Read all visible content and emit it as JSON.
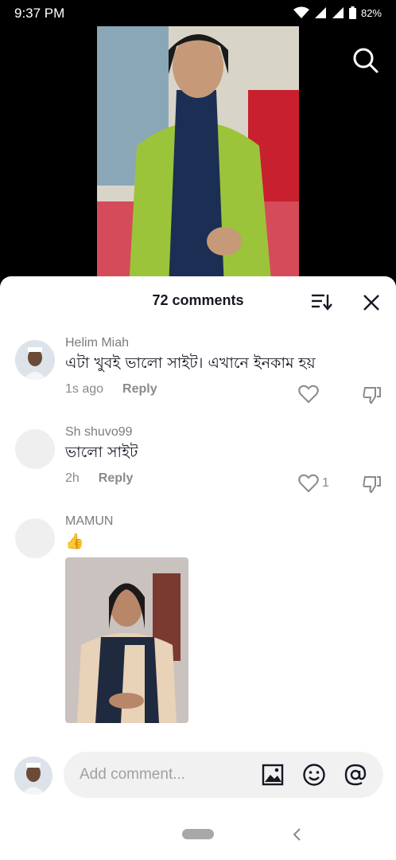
{
  "status_bar": {
    "time": "9:37 PM",
    "battery": "82%"
  },
  "header": {
    "comment_count": "72 comments"
  },
  "comments": [
    {
      "username": "Helim Miah",
      "text": "এটা খুবই ভালো সাইট। এখানে ইনকাম হয়",
      "time": "1s ago",
      "reply_label": "Reply",
      "likes": ""
    },
    {
      "username": "Sh shuvo99",
      "text": "ভালো সাইট",
      "time": "2h",
      "reply_label": "Reply",
      "likes": "1"
    },
    {
      "username": "MAMUN",
      "text": "👍",
      "time": "",
      "reply_label": "",
      "likes": "",
      "has_image": true
    }
  ],
  "composer": {
    "placeholder": "Add comment..."
  },
  "icons": {
    "search": "search-icon",
    "sort": "sort-icon",
    "close": "close-icon",
    "heart": "heart-icon",
    "dislike": "dislike-icon",
    "image": "image-icon",
    "emoji": "emoji-icon",
    "mention": "at-icon",
    "home": "home-pill",
    "back": "back-icon"
  },
  "colors": {
    "primary_text": "#161823",
    "secondary_text": "#8a8a8a",
    "input_bg": "#f1f1f2"
  }
}
